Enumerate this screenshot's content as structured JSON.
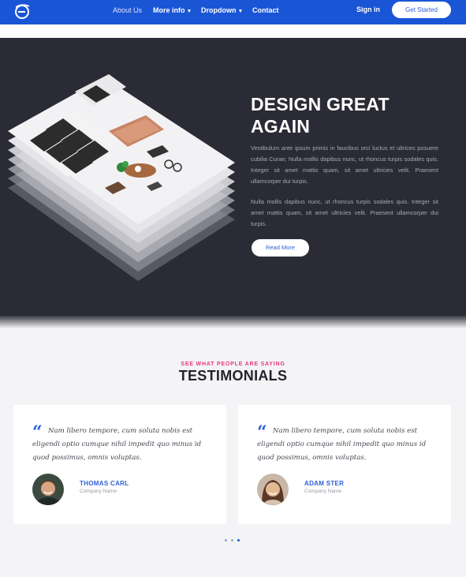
{
  "nav": {
    "links": [
      {
        "label": "About Us"
      },
      {
        "label": "More info"
      },
      {
        "label": "Dropdown"
      },
      {
        "label": "Contact"
      }
    ],
    "sign_in": "Sign in",
    "cta": "Get Started"
  },
  "hero": {
    "title_line1": "DESIGN GREAT",
    "title_line2": "AGAIN",
    "paragraph1": "Vestibulum ante ipsum primis in faucibus orci luctus et ultrices posuere cubilia Curae; Nulla mollis dapibus nunc, ut rhoncus turpis sodales quis. Integer sit amet mattis quam, sit amet ultricies velit. Praesent ullamcorper dui turpis.",
    "paragraph2": "Nulla mollis dapibus nunc, ut rhoncus turpis sodales quis. Integer sit amet mattis quam, sit amet ultricies velit. Praesent ullamcorper dui turpis.",
    "button": "Read More"
  },
  "testimonials": {
    "eyebrow": "SEE WHAT PEOPLE ARE SAYING",
    "title": "TESTIMONIALS",
    "items": [
      {
        "quote": "Nam libero tempore, cum soluta nobis est eligendi optio cumque nihil impedit quo minus id quod possimus, omnis voluptas.",
        "name": "THOMAS CARL",
        "role": "Company Name"
      },
      {
        "quote": "Nam libero tempore, cum soluta nobis est eligendi optio cumque nihil impedit quo minus id quod possimus, omnis voluptas.",
        "name": "ADAM STER",
        "role": "Company Name"
      }
    ],
    "pagination": {
      "count": 3,
      "active": 3
    }
  },
  "colors": {
    "nav_bg": "#1a55d6",
    "hero_bg": "#2b2b36",
    "accent": "#2d5fd8",
    "eyebrow": "#e8387a"
  }
}
